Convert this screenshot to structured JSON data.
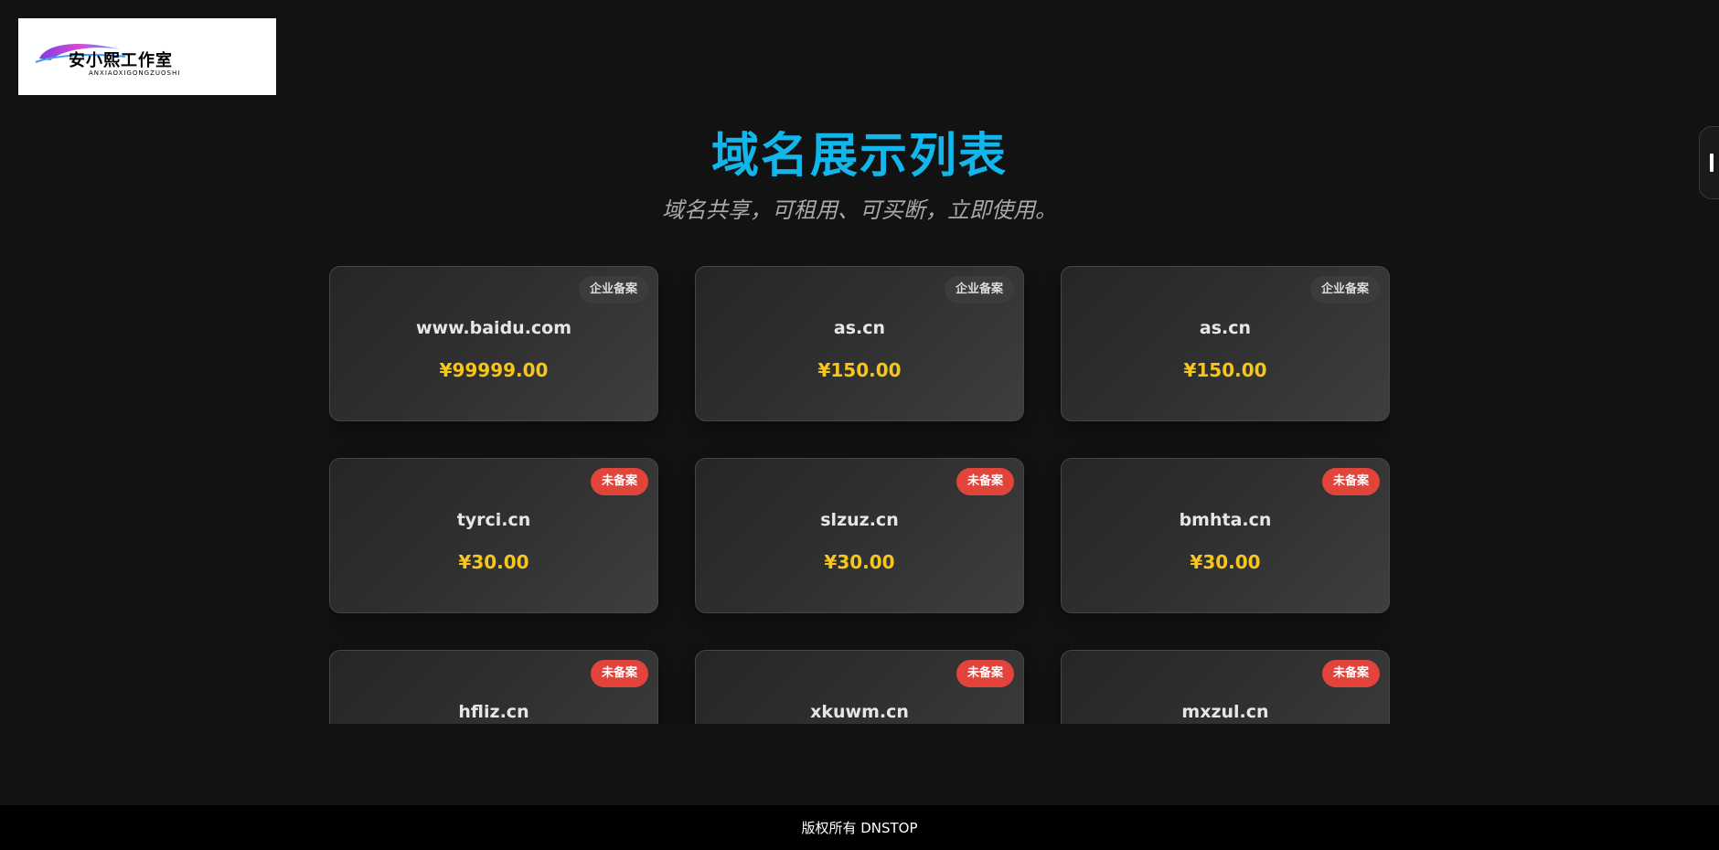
{
  "logo": {
    "text": "安小熙工作室",
    "subtext": "ANXIAOXIGONGZUOSHI"
  },
  "header": {
    "title": "域名展示列表",
    "subtitle": "域名共享，可租用、可买断，立即使用。"
  },
  "colors": {
    "background": "#121212",
    "title": "#13b6ea",
    "price": "#f7c61a",
    "badge_enterprise": "#3c3c3c",
    "badge_unfiled": "#e0443a",
    "footer_bg": "#000000"
  },
  "domains": [
    {
      "name": "www.baidu.com",
      "price": "¥99999.00",
      "badge": "企业备案",
      "badge_type": "enterprise"
    },
    {
      "name": "as.cn",
      "price": "¥150.00",
      "badge": "企业备案",
      "badge_type": "enterprise"
    },
    {
      "name": "as.cn",
      "price": "¥150.00",
      "badge": "企业备案",
      "badge_type": "enterprise"
    },
    {
      "name": "tyrci.cn",
      "price": "¥30.00",
      "badge": "未备案",
      "badge_type": "unfiled"
    },
    {
      "name": "slzuz.cn",
      "price": "¥30.00",
      "badge": "未备案",
      "badge_type": "unfiled"
    },
    {
      "name": "bmhta.cn",
      "price": "¥30.00",
      "badge": "未备案",
      "badge_type": "unfiled"
    },
    {
      "name": "hfliz.cn",
      "price": "",
      "badge": "未备案",
      "badge_type": "unfiled"
    },
    {
      "name": "xkuwm.cn",
      "price": "",
      "badge": "未备案",
      "badge_type": "unfiled"
    },
    {
      "name": "mxzul.cn",
      "price": "",
      "badge": "未备案",
      "badge_type": "unfiled"
    }
  ],
  "footer": {
    "text": "版权所有 DNSTOP"
  }
}
